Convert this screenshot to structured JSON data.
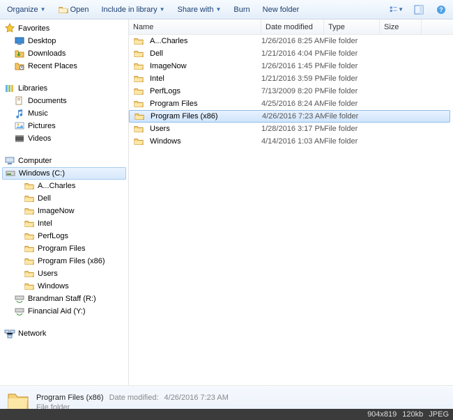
{
  "toolbar": {
    "organize": "Organize",
    "open": "Open",
    "include": "Include in library",
    "share": "Share with",
    "burn": "Burn",
    "new_folder": "New folder"
  },
  "columns": {
    "name": "Name",
    "date": "Date modified",
    "type": "Type",
    "size": "Size"
  },
  "sidebar": {
    "favorites": {
      "label": "Favorites",
      "items": [
        "Desktop",
        "Downloads",
        "Recent Places"
      ]
    },
    "libraries": {
      "label": "Libraries",
      "items": [
        "Documents",
        "Music",
        "Pictures",
        "Videos"
      ]
    },
    "computer": {
      "label": "Computer",
      "items": [
        {
          "label": "Windows (C:)",
          "selected": true,
          "children": [
            "A...Charles",
            "Dell",
            "ImageNow",
            "Intel",
            "PerfLogs",
            "Program Files",
            "Program Files (x86)",
            "Users",
            "Windows"
          ]
        },
        {
          "label": "Brandman Staff (R:)"
        },
        {
          "label": "Financial Aid (Y:)"
        }
      ]
    },
    "network": {
      "label": "Network"
    }
  },
  "files": [
    {
      "name": "A...Charles",
      "date": "1/26/2016 8:25 AM",
      "type": "File folder"
    },
    {
      "name": "Dell",
      "date": "1/21/2016 4:04 PM",
      "type": "File folder"
    },
    {
      "name": "ImageNow",
      "date": "1/26/2016 1:45 PM",
      "type": "File folder"
    },
    {
      "name": "Intel",
      "date": "1/21/2016 3:59 PM",
      "type": "File folder"
    },
    {
      "name": "PerfLogs",
      "date": "7/13/2009 8:20 PM",
      "type": "File folder"
    },
    {
      "name": "Program Files",
      "date": "4/25/2016 8:24 AM",
      "type": "File folder"
    },
    {
      "name": "Program Files (x86)",
      "date": "4/26/2016 7:23 AM",
      "type": "File folder",
      "selected": true
    },
    {
      "name": "Users",
      "date": "1/28/2016 3:17 PM",
      "type": "File folder"
    },
    {
      "name": "Windows",
      "date": "4/14/2016 1:03 AM",
      "type": "File folder"
    }
  ],
  "details": {
    "name": "Program Files (x86)",
    "date_label": "Date modified:",
    "date": "4/26/2016 7:23 AM",
    "type": "File folder"
  },
  "footer": {
    "dims": "904x819",
    "size": "120kb",
    "format": "JPEG"
  }
}
